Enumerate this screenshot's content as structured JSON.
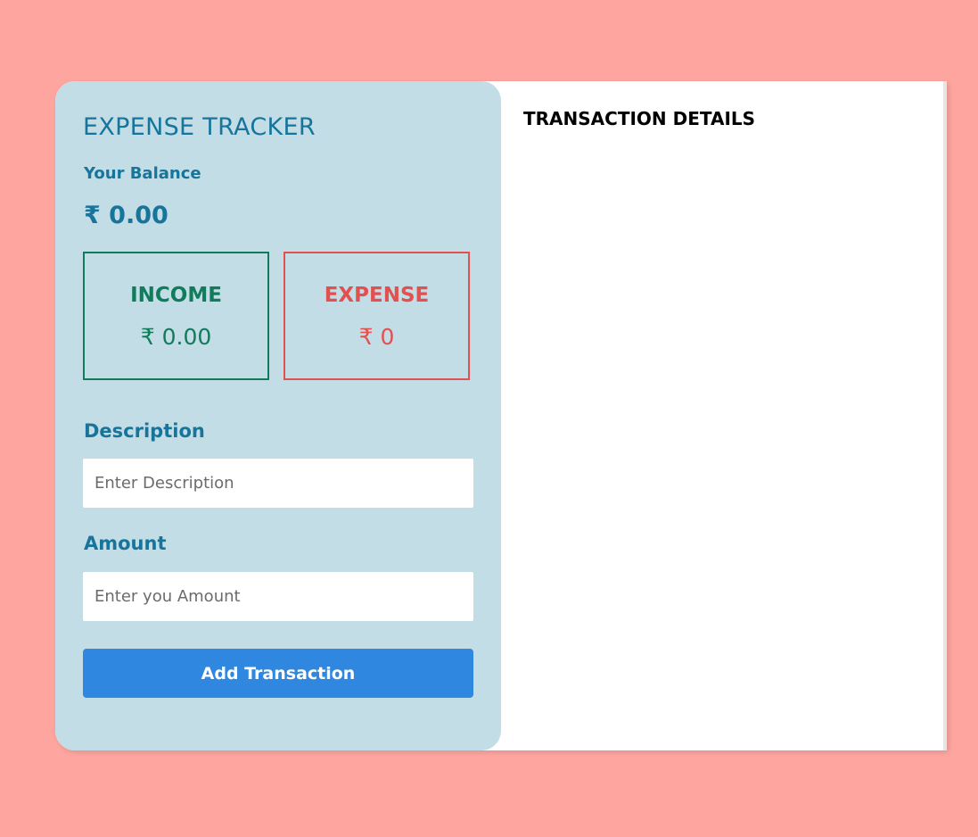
{
  "app": {
    "title": "EXPENSE TRACKER"
  },
  "balance": {
    "label": "Your Balance",
    "value": "₹ 0.00"
  },
  "income": {
    "title": "INCOME",
    "value": "₹ 0.00"
  },
  "expense": {
    "title": "EXPENSE",
    "value": "₹ 0"
  },
  "form": {
    "description_label": "Description",
    "description_placeholder": "Enter Description",
    "description_value": "",
    "amount_label": "Amount",
    "amount_placeholder": "Enter you Amount",
    "amount_value": "",
    "submit_label": "Add Transaction"
  },
  "details": {
    "title": "TRANSACTION DETAILS",
    "transactions": []
  },
  "colors": {
    "page_background": "#fea59f",
    "panel_background": "#c3dde6",
    "primary_text": "#17749a",
    "income": "#117c5c",
    "expense": "#e2504f",
    "button": "#2f87e0"
  }
}
